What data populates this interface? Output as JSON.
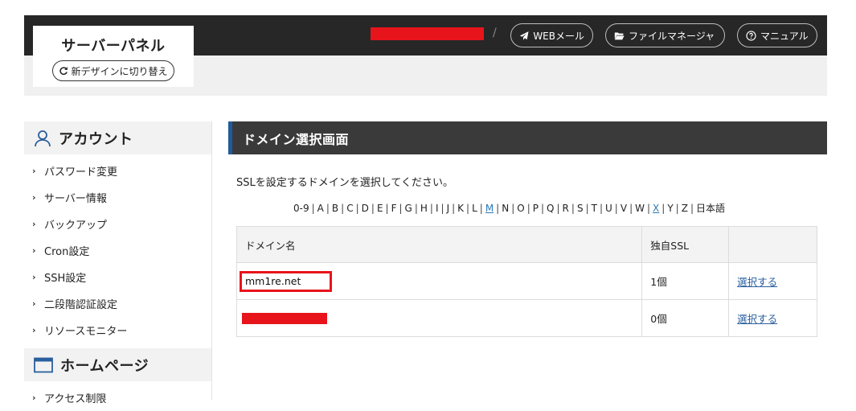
{
  "header": {
    "logo_title": "サーバーパネル",
    "design_switch_label": "新デザインに切り替え",
    "separator": "/",
    "buttons": [
      {
        "label": "WEBメール",
        "icon": "send-icon"
      },
      {
        "label": "ファイルマネージャ",
        "icon": "folder-open-icon"
      },
      {
        "label": "マニュアル",
        "icon": "question-circle-icon"
      }
    ]
  },
  "sidebar": {
    "account_heading": "アカウント",
    "account_items": [
      {
        "label": "パスワード変更"
      },
      {
        "label": "サーバー情報"
      },
      {
        "label": "バックアップ"
      },
      {
        "label": "Cron設定"
      },
      {
        "label": "SSH設定"
      },
      {
        "label": "二段階認証設定"
      },
      {
        "label": "リソースモニター"
      }
    ],
    "homepage_heading": "ホームページ",
    "homepage_items": [
      {
        "label": "アクセス制限"
      }
    ]
  },
  "main": {
    "title": "ドメイン選択画面",
    "instruction": "SSLを設定するドメインを選択してください。",
    "alpha_nav": [
      "0-9",
      "A",
      "B",
      "C",
      "D",
      "E",
      "F",
      "G",
      "H",
      "I",
      "J",
      "K",
      "L",
      "M",
      "N",
      "O",
      "P",
      "Q",
      "R",
      "S",
      "T",
      "U",
      "V",
      "W",
      "X",
      "Y",
      "Z",
      "日本語"
    ],
    "alpha_nav_linked": [
      "M",
      "X"
    ],
    "table": {
      "headers": [
        "ドメイン名",
        "独自SSL",
        ""
      ],
      "rows": [
        {
          "domain": "mm1re.net",
          "ssl_count": "1個",
          "action": "選択する"
        },
        {
          "domain": "",
          "ssl_count": "0個",
          "action": "選択する"
        }
      ]
    }
  },
  "colors": {
    "header_bar": "#272727",
    "title_bar": "#3a3a3a",
    "title_accent": "#1f5c99",
    "redaction": "#e8141b",
    "link": "#2a5f9e"
  }
}
